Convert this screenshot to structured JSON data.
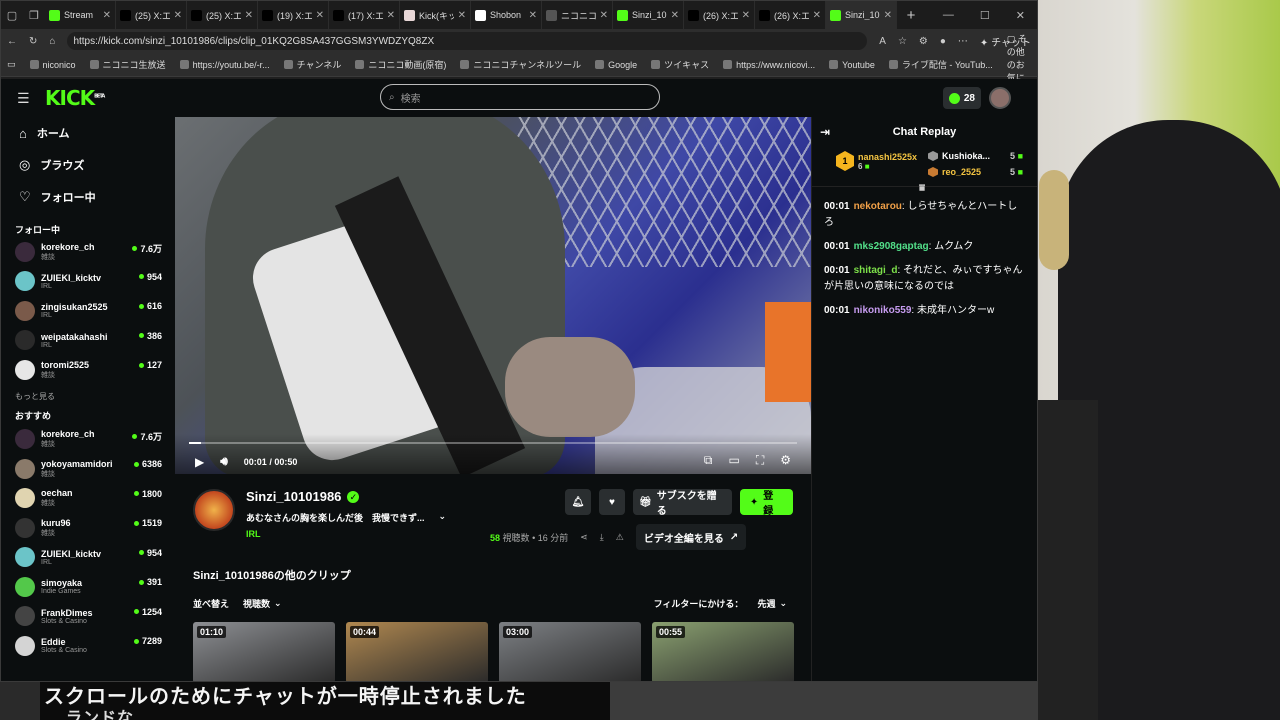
{
  "browser": {
    "tabs": [
      {
        "title": "Stream",
        "color": "#53fc18"
      },
      {
        "title": "(25) X:エー",
        "color": "#000000"
      },
      {
        "title": "(25) X:エー",
        "color": "#000000"
      },
      {
        "title": "(19) X:エー",
        "color": "#000000"
      },
      {
        "title": "(17) X:エー",
        "color": "#000000"
      },
      {
        "title": "Kick(キッ",
        "color": "#e8d7d7"
      },
      {
        "title": "Shobon",
        "color": "#ffffff"
      },
      {
        "title": "ニコニコ生",
        "color": "#555555"
      },
      {
        "title": "Sinzi_10",
        "color": "#53fc18"
      },
      {
        "title": "(26) X:エー",
        "color": "#000000"
      },
      {
        "title": "(26) X:エー",
        "color": "#000000"
      },
      {
        "title": "Sinzi_10",
        "color": "#53fc18"
      }
    ],
    "url": "https://kick.com/sinzi_10101986/clips/clip_01KQ2G8SA437GGSM3YWDZYQ8ZX",
    "copilot_label": "チャット",
    "bookmarks": [
      "niconico",
      "ニコニコ生放送",
      "https://youtu.be/-r...",
      "チャンネル",
      "ニコニコ動画(原宿)",
      "ニコニコチャンネルツール",
      "Google",
      "ツイキャス",
      "https://www.nicovi...",
      "Youtube",
      "ライブ配信 - YouTub..."
    ],
    "bookmarks_more": "その他のお気に入り"
  },
  "kick": {
    "logo": "KICK",
    "logo_beta": "BETA",
    "search_placeholder": "検索",
    "kicks_count": "28",
    "nav": [
      {
        "label": "ホーム",
        "icon": "home-icon"
      },
      {
        "label": "ブラウズ",
        "icon": "browse-icon"
      },
      {
        "label": "フォロー中",
        "icon": "heart-icon"
      }
    ],
    "following_heading": "フォロー中",
    "following": [
      {
        "name": "korekore_ch",
        "category": "雑談",
        "viewers": "7.6万",
        "avatar": "#3a2a3c"
      },
      {
        "name": "ZUIEKI_kicktv",
        "category": "IRL",
        "viewers": "954",
        "avatar": "#6bc4c8"
      },
      {
        "name": "zingisukan2525",
        "category": "IRL",
        "viewers": "616",
        "avatar": "#7a5a4a"
      },
      {
        "name": "weipatakahashi",
        "category": "IRL",
        "viewers": "386",
        "avatar": "#2a2a2a"
      },
      {
        "name": "toromi2525",
        "category": "雑談",
        "viewers": "127",
        "avatar": "#e6e6e6"
      }
    ],
    "see_more": "もっと見る",
    "recommended_heading": "おすすめ",
    "recommended": [
      {
        "name": "korekore_ch",
        "category": "雑談",
        "viewers": "7.6万",
        "avatar": "#3a2a3c"
      },
      {
        "name": "yokoyamamidori",
        "category": "雑談",
        "viewers": "6386",
        "avatar": "#8a7a6a"
      },
      {
        "name": "oechan",
        "category": "雑談",
        "viewers": "1800",
        "avatar": "#e0d4b0"
      },
      {
        "name": "kuru96",
        "category": "雑談",
        "viewers": "1519",
        "avatar": "#333333"
      },
      {
        "name": "ZUIEKI_kicktv",
        "category": "IRL",
        "viewers": "954",
        "avatar": "#6bc4c8"
      },
      {
        "name": "simoyaka",
        "category": "Indie Games",
        "viewers": "391",
        "avatar": "#53c84a"
      },
      {
        "name": "FrankDimes",
        "category": "Slots & Casino",
        "viewers": "1254",
        "avatar": "#444444"
      },
      {
        "name": "Eddie",
        "category": "Slots & Casino",
        "viewers": "7289",
        "avatar": "#d4d4d4"
      }
    ],
    "player": {
      "current_time": "00:01",
      "separator": "/",
      "duration": "00:50",
      "progress": 0.02
    },
    "streamer": {
      "name": "Sinzi_10101986",
      "title": "あむなさんの胸を楽しんだ後　我慢できず...",
      "category": "IRL"
    },
    "actions": {
      "subscribe_gift": "サブスクを贈る",
      "register": "登録",
      "full_video": "ビデオ全編を見る"
    },
    "stats": {
      "views": "58",
      "views_label": "視聴数",
      "dot": "•",
      "time_ago": "16 分前"
    },
    "more_clips_title": "Sinzi_10101986の他のクリップ",
    "sort_label": "並べ替え",
    "sort_value": "視聴数",
    "filter_label": "フィルターにかける：",
    "filter_value": "先週",
    "clips": [
      {
        "duration": "01:10",
        "bg": "#8d8f93"
      },
      {
        "duration": "00:44",
        "bg": "#b08850"
      },
      {
        "duration": "03:00",
        "bg": "#7d8084"
      },
      {
        "duration": "00:55",
        "bg": "#8aa070"
      }
    ]
  },
  "chat": {
    "title": "Chat Replay",
    "leaders": [
      {
        "rank": "1",
        "name": "nanashi2525x",
        "count": "6"
      },
      {
        "name": "Kushioka...",
        "count": "5"
      },
      {
        "name": "reo_2525",
        "count": "5"
      }
    ],
    "messages": [
      {
        "time": "00:01",
        "user": "nekotarou",
        "color": "#f0a048",
        "text": "しらせちゃんとハートしろ"
      },
      {
        "time": "00:01",
        "user": "mks2908gaptag",
        "color": "#53e08a",
        "text": "ムクムク"
      },
      {
        "time": "00:01",
        "user": "shitagi_d",
        "color": "#7de04a",
        "text": "それだと、みぃですちゃんが片思いの意味になるのでは"
      },
      {
        "time": "00:01",
        "user": "nikoniko559",
        "color": "#c79cf0",
        "text": "未成年ハンターw"
      }
    ]
  },
  "overlay": {
    "subtitle": "スクロールのためにチャットが一時停止されました",
    "subtitle2": "ランドな"
  }
}
